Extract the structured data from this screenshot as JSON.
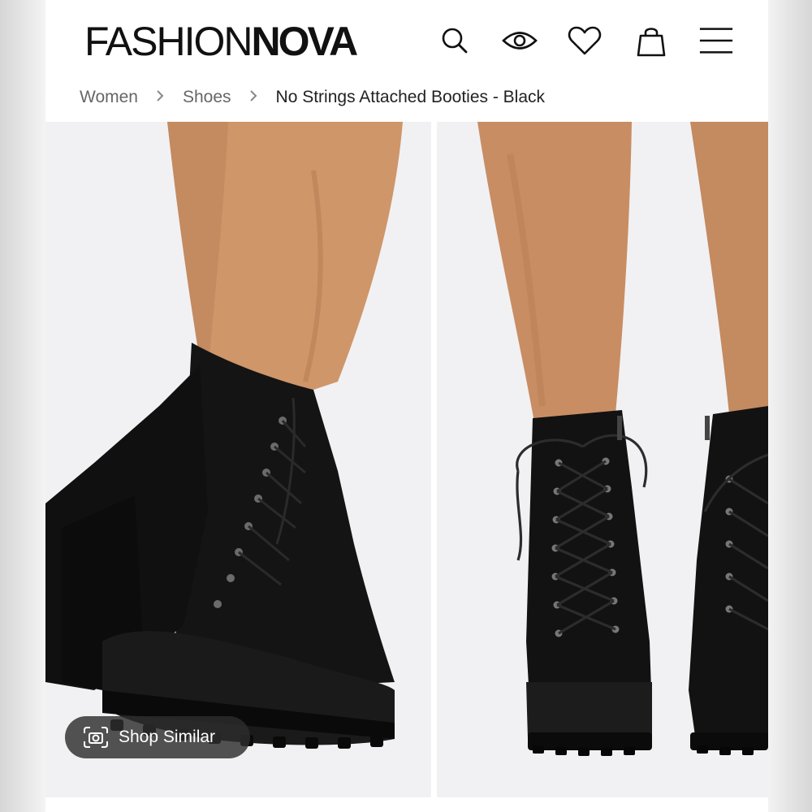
{
  "brand": {
    "logo_thin": "FASHION",
    "logo_bold": "NOVA"
  },
  "header_icons": [
    "search-icon",
    "eye-icon",
    "heart-icon",
    "shopping-bag-icon",
    "menu-icon"
  ],
  "breadcrumb": {
    "items": [
      "Women",
      "Shoes",
      "No Strings Attached Booties - Black"
    ],
    "separator": ">"
  },
  "gallery": {
    "shop_similar_label": "Shop Similar"
  },
  "colors": {
    "page_bg": "#ffffff",
    "text": "#111111",
    "muted": "#666666",
    "photo_bg": "#f1f1f3",
    "boot": "#121212",
    "skin": "#c98d63",
    "pill_bg": "#2d2d2d"
  }
}
